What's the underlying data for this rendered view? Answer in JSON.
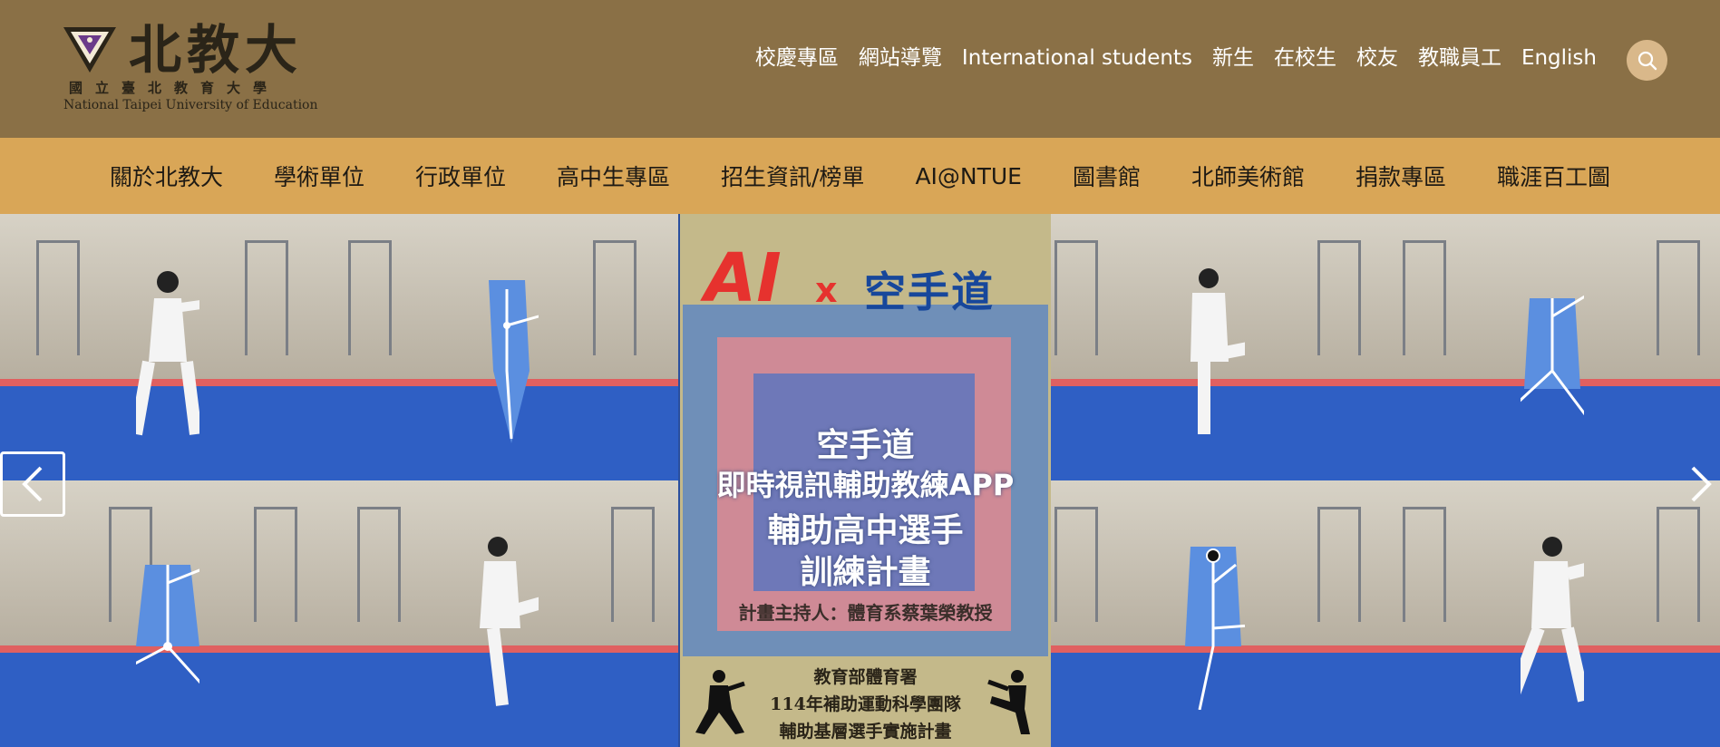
{
  "logo": {
    "name": "北教大",
    "subtitle": "國立臺北教育大學",
    "english": "National Taipei University of Education"
  },
  "utility_nav": [
    "校慶專區",
    "網站導覽",
    "International students",
    "新生",
    "在校生",
    "校友",
    "教職員工",
    "English"
  ],
  "main_nav": [
    "關於北教大",
    "學術單位",
    "行政單位",
    "高中生專區",
    "招生資訊/榜單",
    "AI@NTUE",
    "圖書館",
    "北師美術館",
    "捐款專區",
    "職涯百工圖"
  ],
  "banner": {
    "title_ai": "AI",
    "title_x": "x",
    "title_karate": "空手道",
    "lines": [
      "空手道",
      "即時視訊輔助教練APP",
      "輔助高中選手",
      "訓練計畫"
    ],
    "host": "計畫主持人：體育系蔡葉榮教授",
    "footer": [
      "教育部體育署",
      "114年補助運動科學團隊",
      "輔助基層選手實施計畫"
    ]
  },
  "colors": {
    "header_bg": "#8a7046",
    "nav_bg": "#d9a657",
    "accent_red": "#e6322e",
    "accent_blue": "#17479b"
  },
  "icons": {
    "search": "search-icon",
    "prev": "chevron-left-icon",
    "next": "chevron-right-icon"
  }
}
